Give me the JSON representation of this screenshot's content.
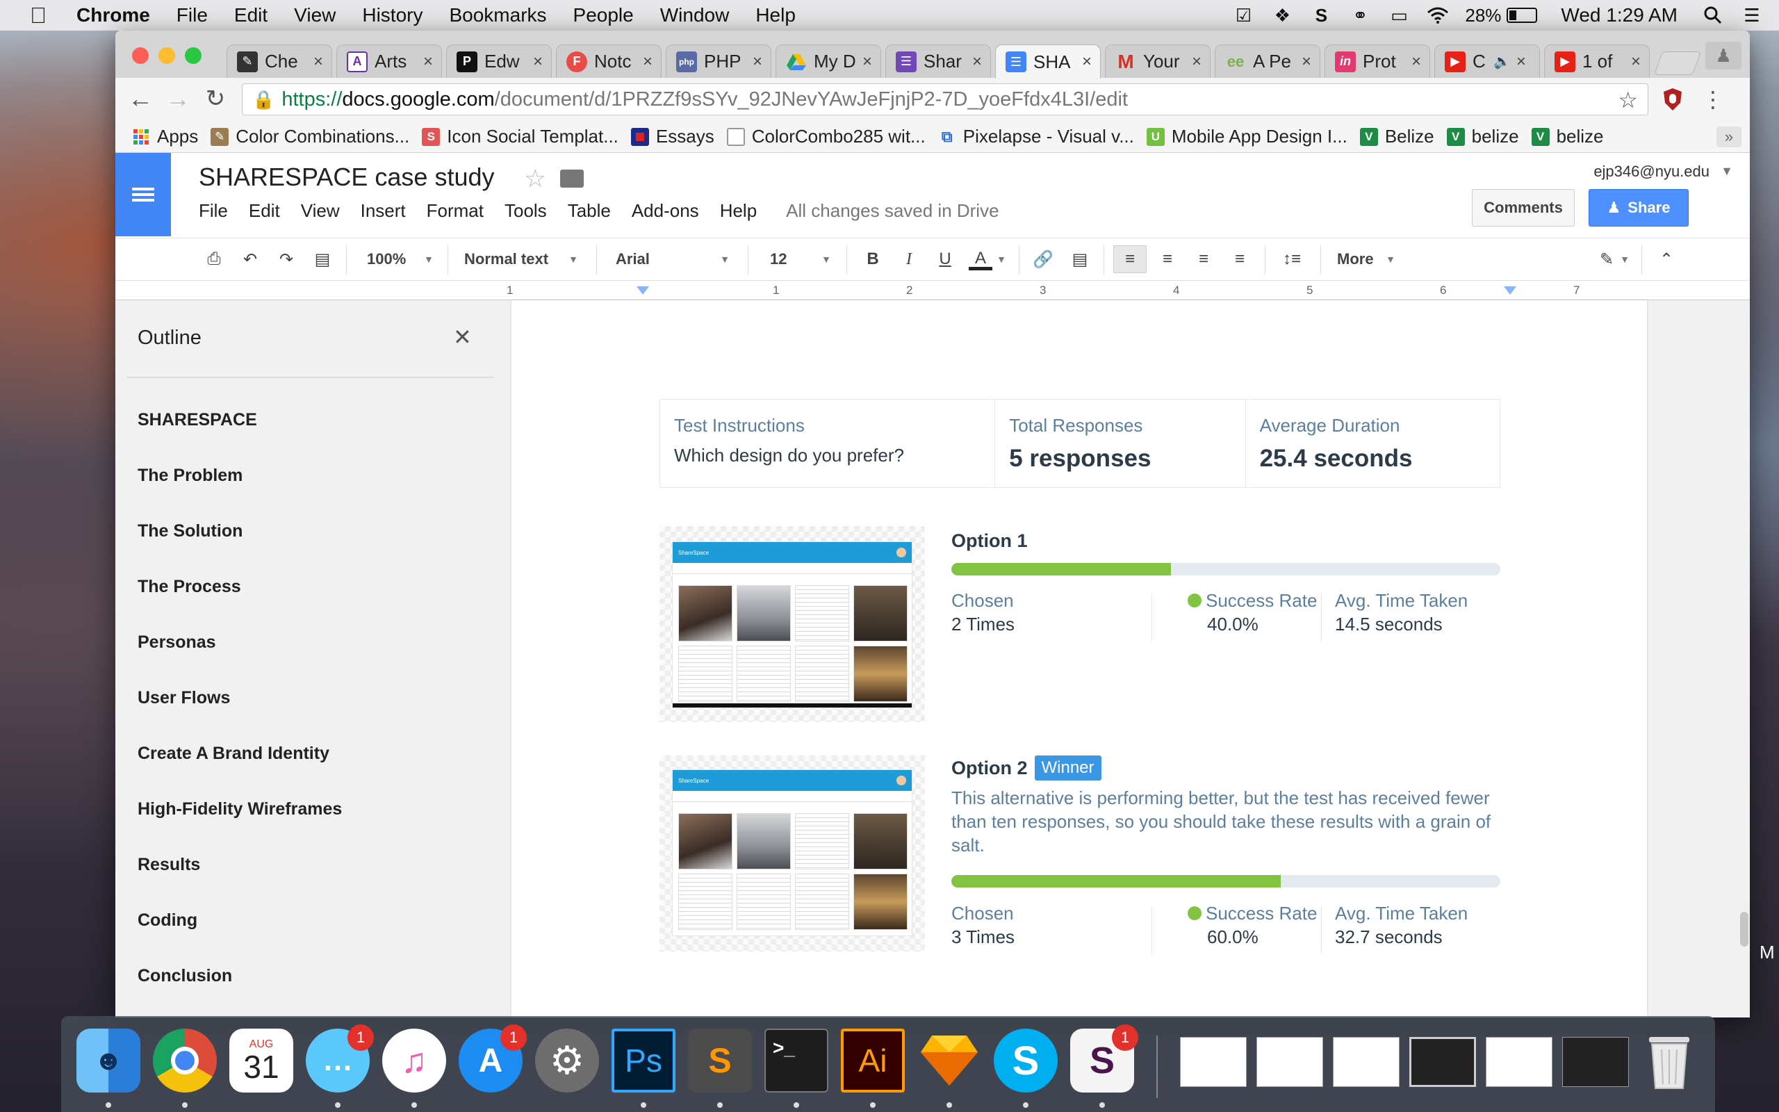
{
  "menubar": {
    "app_name": "Chrome",
    "items": [
      "File",
      "Edit",
      "View",
      "History",
      "Bookmarks",
      "People",
      "Window",
      "Help"
    ],
    "battery": "28%",
    "clock": "Wed 1:29 AM"
  },
  "browser": {
    "tabs": [
      {
        "title": "Che",
        "icon": "pen-icon",
        "color": "#333333"
      },
      {
        "title": "Arts",
        "icon": "a-icon",
        "color": "#6f2da8"
      },
      {
        "title": "Edw",
        "icon": "p-icon",
        "color": "#111111"
      },
      {
        "title": "Notc",
        "icon": "f-icon",
        "color": "#e94b46"
      },
      {
        "title": "PHP",
        "icon": "php-icon",
        "color": "#5a6aa6"
      },
      {
        "title": "My D",
        "icon": "drive-icon",
        "color": "#1fa463"
      },
      {
        "title": "Shar",
        "icon": "forms-icon",
        "color": "#7248b9"
      },
      {
        "title": "SHA",
        "icon": "docs-icon",
        "color": "#4285f4",
        "active": true
      },
      {
        "title": "Your",
        "icon": "gmail-icon",
        "color": "#d93025"
      },
      {
        "title": "A Pe",
        "icon": "ee-icon",
        "color": "#7cb342"
      },
      {
        "title": "Prot",
        "icon": "invision-icon",
        "color": "#e4396f"
      },
      {
        "title": "C",
        "icon": "youtube-icon",
        "color": "#e62117"
      },
      {
        "title": "1 of",
        "icon": "youtube-icon",
        "color": "#e62117"
      }
    ],
    "url": {
      "scheme": "https://",
      "domain": "docs.google.com",
      "path": "/document/d/1PRZZf9sSYv_92JNevYAwJeFjnjP2-7D_yoeFfdx4L3I/edit"
    },
    "bookmarks": [
      {
        "label": "Apps",
        "icon": "apps-grid-icon",
        "color": "#f4b400"
      },
      {
        "label": "Color Combinations...",
        "icon": "pencil-bookmark-icon",
        "color": "#9b7b54"
      },
      {
        "label": "Icon Social Templat...",
        "icon": "s-icon",
        "color": "#e25555"
      },
      {
        "label": "Essays",
        "icon": "flag-icon",
        "color": "#1d2a8c"
      },
      {
        "label": "ColorCombo285 wit...",
        "icon": "page-icon",
        "color": "#999999"
      },
      {
        "label": "Pixelapse - Visual v...",
        "icon": "pixelapse-icon",
        "color": "#2d6fd6"
      },
      {
        "label": "Mobile App Design I...",
        "icon": "u-icon",
        "color": "#74c044"
      },
      {
        "label": "Belize",
        "icon": "v-icon",
        "color": "#1e8c45"
      },
      {
        "label": "belize",
        "icon": "v-icon",
        "color": "#1e8c45"
      },
      {
        "label": "belize",
        "icon": "v-icon",
        "color": "#1e8c45"
      }
    ]
  },
  "docs": {
    "title": "SHARESPACE case study",
    "menu": [
      "File",
      "Edit",
      "View",
      "Insert",
      "Format",
      "Tools",
      "Table",
      "Add-ons",
      "Help"
    ],
    "save_status": "All changes saved in Drive",
    "account": "ejp346@nyu.edu",
    "comments_label": "Comments",
    "share_label": "Share",
    "toolbar": {
      "zoom": "100%",
      "style": "Normal text",
      "font": "Arial",
      "size": "12",
      "more": "More"
    },
    "ruler": [
      "1",
      "1",
      "2",
      "3",
      "4",
      "5",
      "6",
      "7"
    ]
  },
  "outline": {
    "title": "Outline",
    "items": [
      "SHARESPACE",
      "The Problem",
      "The Solution",
      "The Process",
      "Personas",
      "User Flows",
      "Create A Brand Identity",
      "High-Fidelity Wireframes",
      "Results",
      "Coding",
      "Conclusion"
    ]
  },
  "test": {
    "instructions_label": "Test Instructions",
    "instructions": "Which design do you prefer?",
    "responses_label": "Total Responses",
    "responses": "5 responses",
    "duration_label": "Average Duration",
    "duration": "25.4 seconds",
    "options": [
      {
        "title": "Option 1",
        "winner": false,
        "note": "",
        "bar_fraction": 0.4,
        "chosen_label": "Chosen",
        "chosen": "2 Times",
        "success_label": "Success Rate",
        "success": "40.0%",
        "time_label": "Avg. Time Taken",
        "time": "14.5 seconds",
        "mock_brand": "ShareSpace"
      },
      {
        "title": "Option 2",
        "winner": true,
        "winner_label": "Winner",
        "note": "This alternative is performing better, but the test has received fewer than ten responses, so you should take these results with a grain of salt.",
        "bar_fraction": 0.6,
        "chosen_label": "Chosen",
        "chosen": "3 Times",
        "success_label": "Success Rate",
        "success": "60.0%",
        "time_label": "Avg. Time Taken",
        "time": "32.7 seconds",
        "mock_brand": "ShareSpace"
      }
    ]
  },
  "dock": {
    "apps": [
      {
        "name": "finder-icon",
        "color": "#4aa7f0"
      },
      {
        "name": "chrome-icon",
        "color": "#dd4b39"
      },
      {
        "name": "calendar-icon",
        "color": "#ffffff",
        "month": "AUG",
        "day": "31"
      },
      {
        "name": "messages-icon",
        "color": "#5ac8fa",
        "badge": "1"
      },
      {
        "name": "itunes-icon",
        "color": "#f45bb0"
      },
      {
        "name": "app-store-icon",
        "color": "#1d8cf2",
        "badge": "1"
      },
      {
        "name": "system-preferences-icon",
        "color": "#6d6d6d"
      },
      {
        "name": "photoshop-icon",
        "color": "#001d34",
        "label": "Ps"
      },
      {
        "name": "sublime-icon",
        "color": "#4b4b4b",
        "label": "S"
      },
      {
        "name": "terminal-icon",
        "color": "#1d1d1d",
        "label": ">_"
      },
      {
        "name": "illustrator-icon",
        "color": "#330000",
        "label": "Ai"
      },
      {
        "name": "sketch-icon",
        "color": "#f7b500"
      },
      {
        "name": "skype-icon",
        "color": "#00aff0",
        "label": "S"
      },
      {
        "name": "slack-icon",
        "color": "#e9e9e9",
        "label": "S",
        "badge": "1"
      }
    ],
    "minimized_count": 6
  },
  "edge_letter": "M"
}
